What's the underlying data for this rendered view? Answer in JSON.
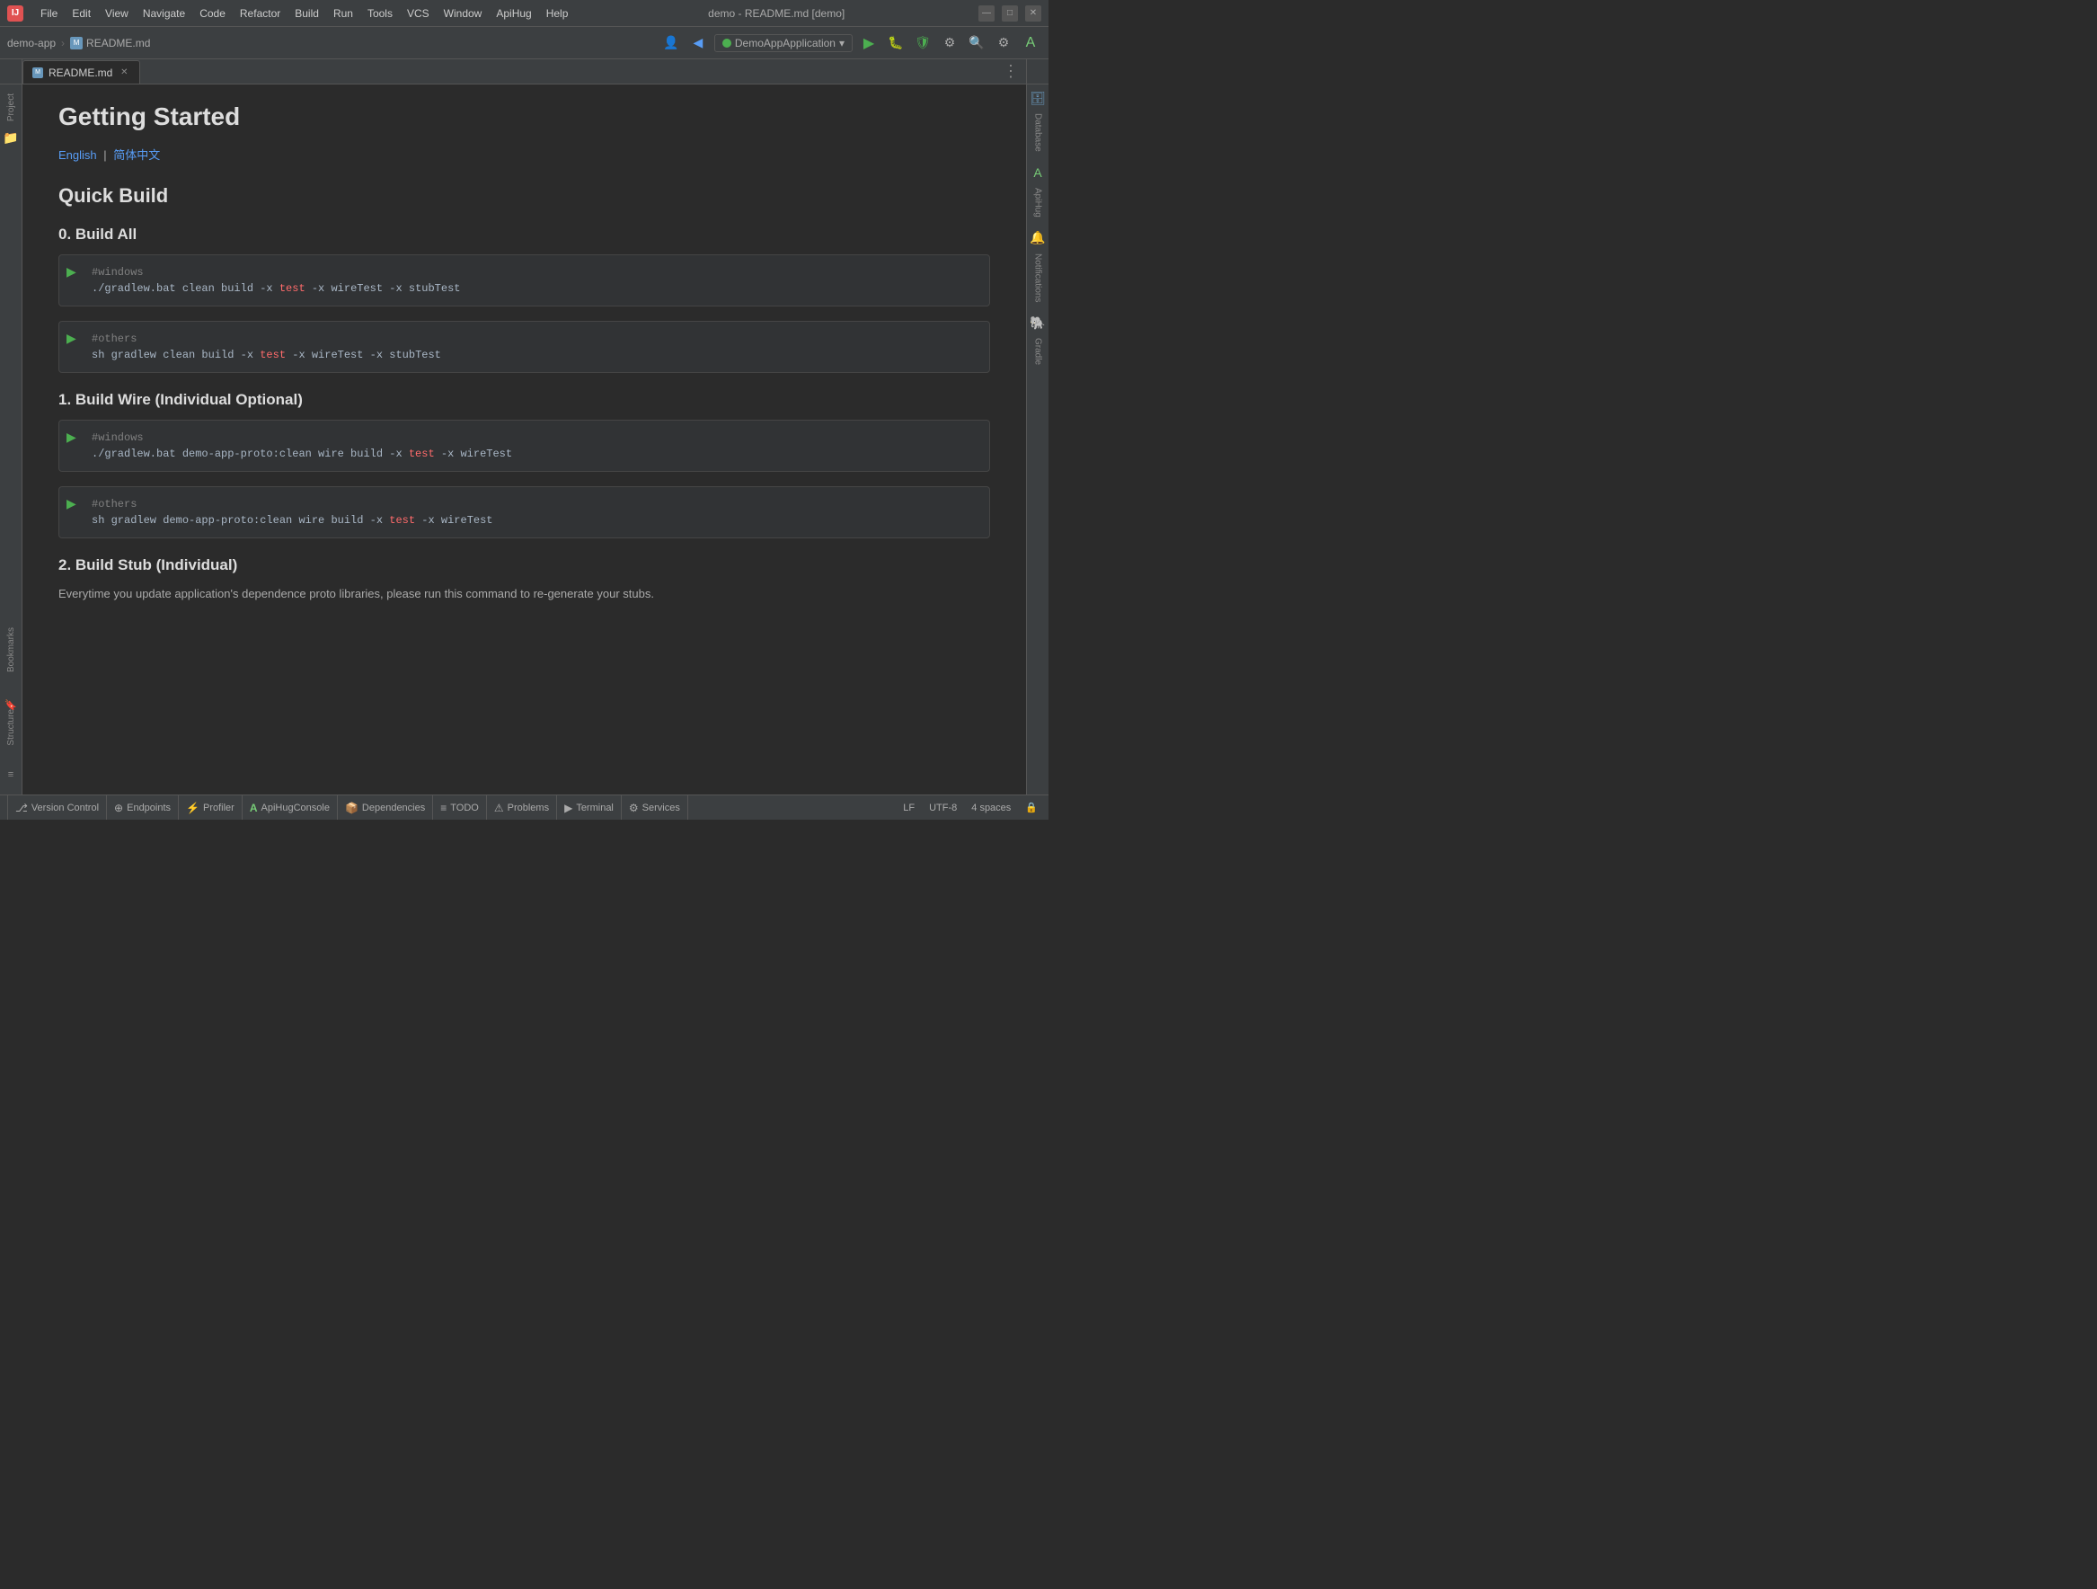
{
  "window": {
    "title": "demo - README.md [demo]",
    "app_icon": "IJ"
  },
  "menu": {
    "items": [
      "File",
      "Edit",
      "View",
      "Navigate",
      "Code",
      "Refactor",
      "Build",
      "Run",
      "Tools",
      "VCS",
      "Window",
      "ApiHug",
      "Help"
    ]
  },
  "toolbar": {
    "breadcrumb_project": "demo-app",
    "breadcrumb_sep": "›",
    "breadcrumb_file": "README.md",
    "run_config_label": "DemoAppApplication",
    "run_config_dropdown": "▾"
  },
  "tabs": [
    {
      "label": "README.md",
      "closeable": true,
      "active": true
    }
  ],
  "content": {
    "h1": "Getting Started",
    "lang_link_en": "English",
    "lang_sep": "|",
    "lang_link_zh": "简体中文",
    "h2_quick_build": "Quick Build",
    "h3_build_all": "0. Build All",
    "code_block_1_comment": "#windows",
    "code_block_1_cmd": "./gradlew.bat clean build -x ",
    "code_block_1_highlight": "test",
    "code_block_1_rest": " -x wireTest -x stubTest",
    "code_block_2_comment": "#others",
    "code_block_2_cmd": "sh gradlew clean build -x ",
    "code_block_2_highlight": "test",
    "code_block_2_rest": " -x wireTest -x stubTest",
    "h3_build_wire": "1. Build Wire (Individual Optional)",
    "code_block_3_comment": "#windows",
    "code_block_3_cmd": "./gradlew.bat demo-app-proto:clean wire build -x ",
    "code_block_3_highlight": "test",
    "code_block_3_rest": " -x wireTest",
    "code_block_4_comment": "#others",
    "code_block_4_cmd": "sh gradlew demo-app-proto:clean wire build -x ",
    "code_block_4_highlight": "test",
    "code_block_4_rest": " -x wireTest",
    "h3_build_stub": "2. Build Stub (Individual)",
    "stub_desc": "Everytime you update application's dependence proto libraries, please run this command to re-generate your stubs."
  },
  "right_sidebar": {
    "database_label": "Database",
    "apihug_label": "ApiHug",
    "notifications_label": "Notifications",
    "gradle_label": "Gradle"
  },
  "left_sidebar": {
    "project_label": "Project",
    "bookmarks_label": "Bookmarks",
    "structure_label": "Structure"
  },
  "status_bar": {
    "items": [
      {
        "icon": "⎇",
        "label": "Version Control"
      },
      {
        "icon": "⊕",
        "label": "Endpoints"
      },
      {
        "icon": "⚡",
        "label": "Profiler"
      },
      {
        "icon": "A",
        "label": "ApiHugConsole"
      },
      {
        "icon": "📦",
        "label": "Dependencies"
      },
      {
        "icon": "≡",
        "label": "TODO"
      },
      {
        "icon": "⚠",
        "label": "Problems"
      },
      {
        "icon": "▶",
        "label": "Terminal"
      },
      {
        "icon": "⚙",
        "label": "Services"
      }
    ],
    "right": {
      "lf": "LF",
      "encoding": "UTF-8",
      "indent": "4 spaces",
      "lock_icon": "🔒"
    }
  },
  "colors": {
    "accent_green": "#4CAF50",
    "accent_blue": "#589df6",
    "accent_red": "#ff6b6b",
    "bg_dark": "#2b2b2b",
    "bg_toolbar": "#3c3f41",
    "text_comment": "#808080",
    "text_main": "#a9b7c6"
  }
}
